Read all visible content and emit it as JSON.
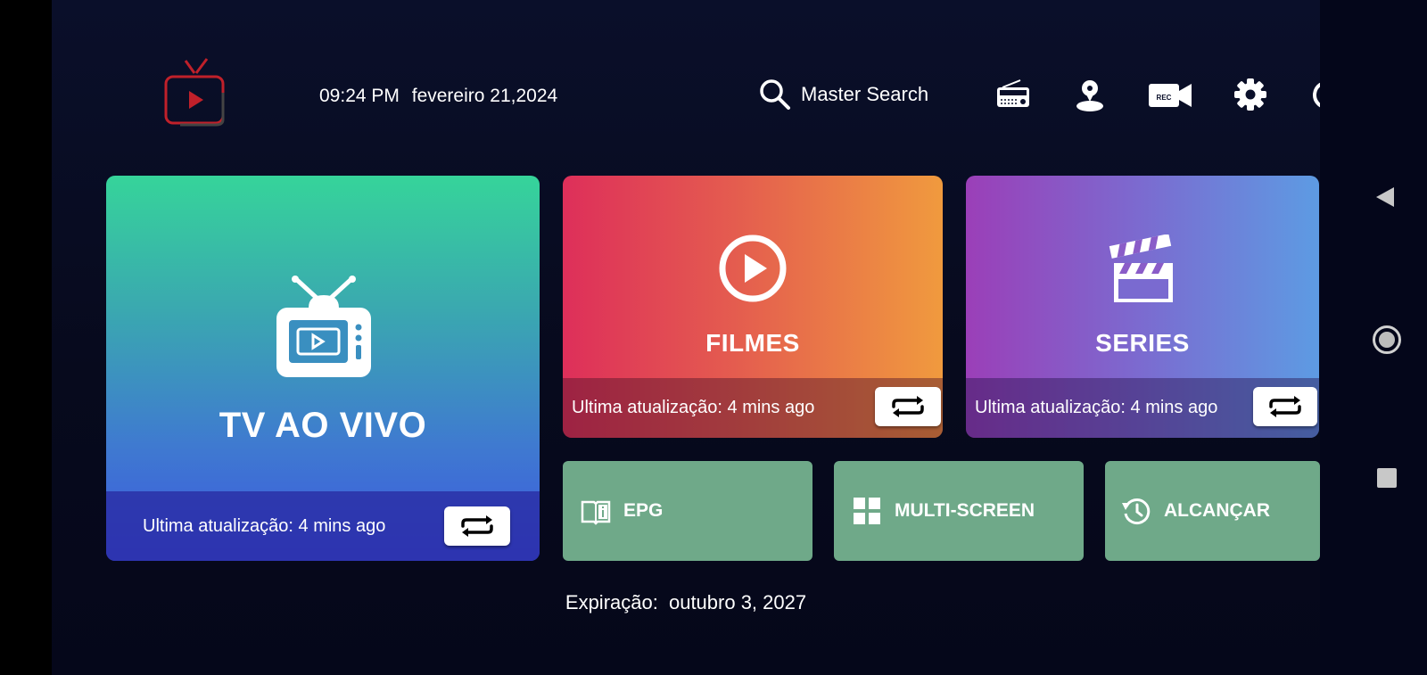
{
  "header": {
    "time": "09:24 PM",
    "date": "fevereiro 21,2024",
    "search_label": "Master Search",
    "icons": [
      "radio-icon",
      "user-icon",
      "rec-camera-icon",
      "gear-icon",
      "power-icon"
    ],
    "rec_label": "REC"
  },
  "tiles": {
    "live": {
      "title": "TV AO VIVO",
      "updated": "Ultima atualização: 4 mins ago"
    },
    "movies": {
      "title": "FILMES",
      "updated": "Ultima atualização: 4 mins ago"
    },
    "series": {
      "title": "SERIES",
      "updated": "Ultima atualização: 4 mins ago"
    }
  },
  "small_tiles": {
    "epg": "EPG",
    "multiscreen": "MULTI-SCREEN",
    "reach": "ALCANÇAR"
  },
  "footer": {
    "expiry_label": "Expiração:",
    "expiry_date": "outubro 3, 2027"
  },
  "colors": {
    "live_top": "#36d49a",
    "live_bottom": "#3d57e0",
    "movies_left": "#de2f5a",
    "movies_right": "#f09a3e",
    "series_left": "#9b3fb8",
    "series_right": "#5d9be3",
    "small_tile": "#6fa989",
    "background": "#070a1d"
  }
}
